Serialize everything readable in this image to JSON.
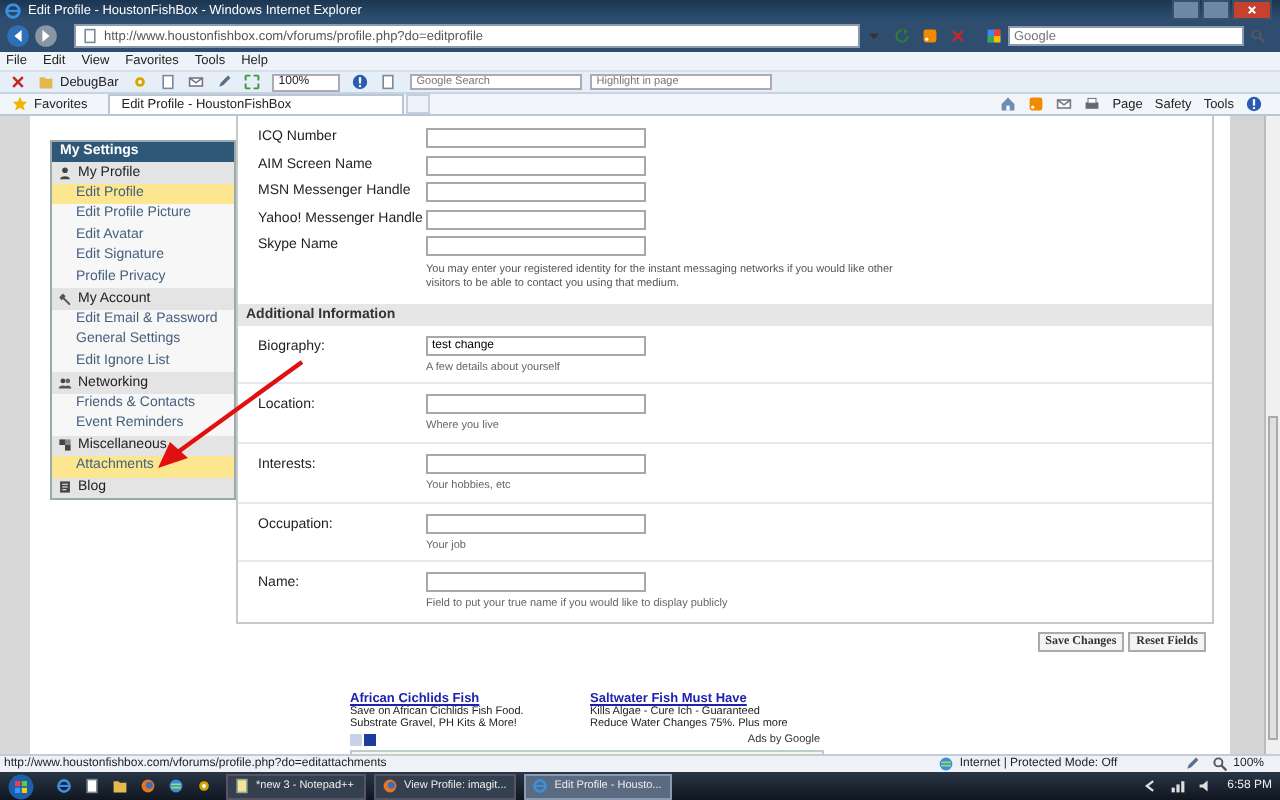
{
  "window": {
    "title": "Edit Profile - HoustonFishBox - Windows Internet Explorer"
  },
  "address_bar": {
    "url": "http://www.houstonfishbox.com/vforums/profile.php?do=editprofile"
  },
  "search_box": {
    "placeholder": "Google"
  },
  "menu_bar": [
    "File",
    "Edit",
    "View",
    "Favorites",
    "Tools",
    "Help"
  ],
  "toolbar": {
    "debugbar": "DebugBar",
    "zoom": "100%",
    "search_placeholder": "Google Search",
    "highlight_placeholder": "Highlight in page"
  },
  "favorites": "Favorites",
  "tabs": [
    {
      "label": "Edit Profile - HoustonFishBox",
      "selected": true
    }
  ],
  "command_bar": [
    "Page",
    "Safety",
    "Tools"
  ],
  "sidebar": {
    "title": "My Settings",
    "groups": [
      {
        "label": "My Profile",
        "kind": "person",
        "children": [
          {
            "label": "Edit Profile",
            "selected": true
          },
          {
            "label": "Edit Profile Picture",
            "selected": false
          },
          {
            "label": "Edit Avatar",
            "selected": false
          },
          {
            "label": "Edit Signature",
            "selected": false
          },
          {
            "label": "Profile Privacy",
            "selected": false
          }
        ]
      },
      {
        "label": "My Account",
        "kind": "wrench",
        "children": [
          {
            "label": "Edit Email & Password",
            "selected": false
          },
          {
            "label": "General Settings",
            "selected": false
          },
          {
            "label": "Edit Ignore List",
            "selected": false
          }
        ]
      },
      {
        "label": "Networking",
        "kind": "people",
        "children": [
          {
            "label": "Friends & Contacts",
            "selected": false
          },
          {
            "label": "Event Reminders",
            "selected": false
          }
        ]
      },
      {
        "label": "Miscellaneous",
        "kind": "puzzle",
        "children": [
          {
            "label": "Attachments",
            "selected": true
          }
        ]
      },
      {
        "label": "Blog",
        "kind": "blog"
      }
    ]
  },
  "form": {
    "im_fields": [
      {
        "label": "ICQ Number"
      },
      {
        "label": "AIM Screen Name"
      },
      {
        "label": "MSN Messenger Handle"
      },
      {
        "label": "Yahoo! Messenger Handle"
      },
      {
        "label": "Skype Name"
      }
    ],
    "im_note": "You may enter your registered identity for the instant messaging networks if you would like other visitors to be able to contact you using that medium.",
    "section_title": "Additional Information",
    "fields": [
      {
        "label": "Biography:",
        "value": "test change",
        "hint": "A few details about yourself"
      },
      {
        "label": "Location:",
        "hint": "Where you live"
      },
      {
        "label": "Interests:",
        "hint": "Your hobbies, etc"
      },
      {
        "label": "Occupation:",
        "hint": "Your job"
      },
      {
        "label": "Name:",
        "hint": "Field to put your true name if you would like to display publicly"
      }
    ],
    "buttons": [
      "Save Changes",
      "Reset Fields"
    ]
  },
  "ads": {
    "items": [
      {
        "title": "African Cichlids Fish",
        "lines": [
          "Save on African Cichlids Fish Food.",
          "Substrate Gravel, PH Kits & More!"
        ]
      },
      {
        "title": "Saltwater Fish Must Have",
        "lines": [
          "Kills Algae - Cure Ich - Guaranteed",
          "Reduce Water Changes 75%. Plus more"
        ]
      }
    ],
    "attribution": "Ads by Google"
  },
  "status_bar": {
    "url": "http://www.houstonfishbox.com/vforums/profile.php?do=editattachments",
    "zone": "Internet | Protected Mode: Off",
    "zoom": "100%"
  },
  "taskbar": {
    "items": [
      {
        "label": "*new 3 - Notepad++",
        "selected": false
      },
      {
        "label": "View Profile: imagit...",
        "selected": false
      },
      {
        "label": "Edit Profile - Housto...",
        "selected": true
      }
    ],
    "clock": "6:58 PM"
  }
}
